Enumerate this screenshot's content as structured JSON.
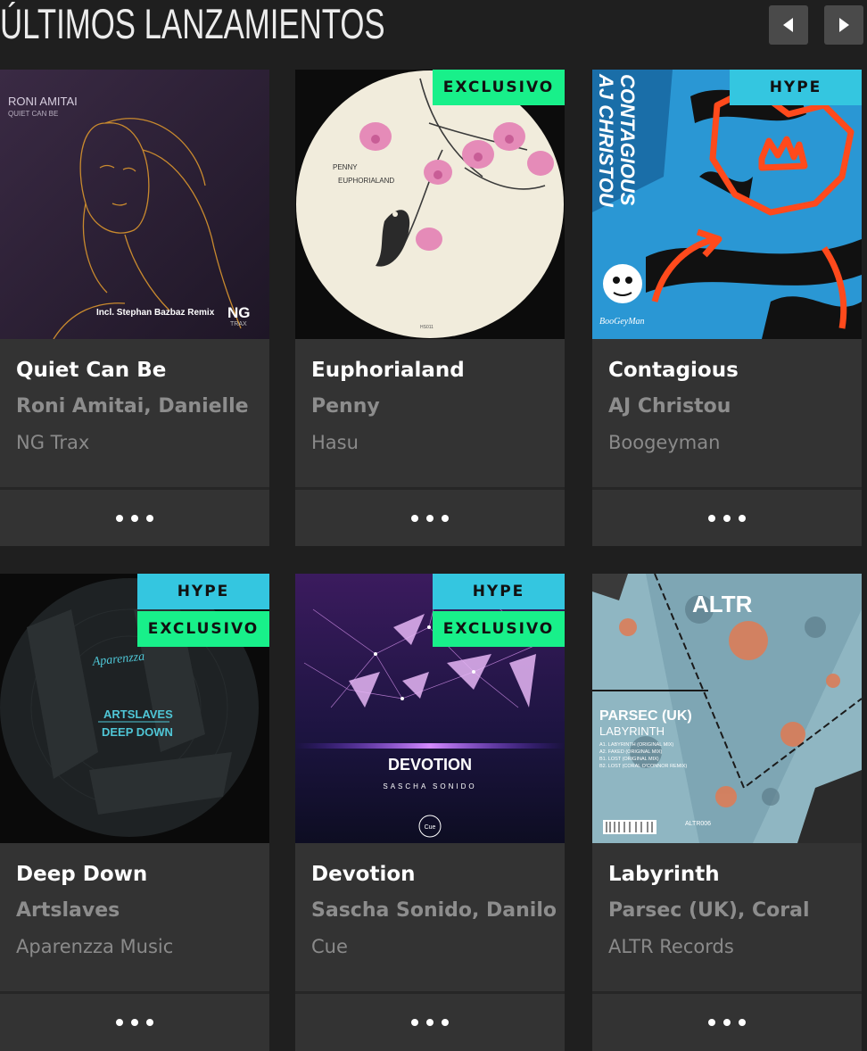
{
  "section": {
    "title": "ÚLTIMOS LANZAMIENTOS"
  },
  "nav": {
    "prev_icon": "caret-left-icon",
    "next_icon": "caret-right-icon"
  },
  "colors": {
    "hype": "#34c6e0",
    "exclusive": "#18f08a",
    "card_bg": "#333333",
    "page_bg": "#1f1f1f"
  },
  "releases": [
    {
      "title": "Quiet Can Be",
      "artists": "Roni Amitai, Danielle",
      "label": "NG Trax",
      "badges": [],
      "cover": {
        "line1": "RONI AMITAI",
        "line2": "QUIET CAN BE",
        "line3": "Incl. Stephan Bazbaz Remix",
        "logo": "NG",
        "logo_sub": "TRAX"
      }
    },
    {
      "title": "Euphorialand",
      "artists": "Penny",
      "label": "Hasu",
      "badges": [
        "EXCLUSIVO"
      ],
      "cover": {
        "line1": "PENNY",
        "line2": "EUPHORIALAND",
        "code": "HS011"
      }
    },
    {
      "title": "Contagious",
      "artists": "AJ Christou",
      "label": "Boogeyman",
      "badges": [
        "HYPE"
      ],
      "cover": {
        "line1": "AJ CHRISTOU",
        "line2": "CONTAGIOUS",
        "logo": "BooGeyMan"
      }
    },
    {
      "title": "Deep Down",
      "artists": "Artslaves",
      "label": "Aparenzza Music",
      "badges": [
        "HYPE",
        "EXCLUSIVO"
      ],
      "cover": {
        "line1": "ARTSLAVES",
        "line2": "DEEP DOWN"
      }
    },
    {
      "title": "Devotion",
      "artists": "Sascha Sonido, Danilo",
      "label": "Cue",
      "badges": [
        "HYPE",
        "EXCLUSIVO"
      ],
      "cover": {
        "line1": "DEVOTION",
        "line2": "SASCHA SONIDO",
        "logo": "Cue"
      }
    },
    {
      "title": "Labyrinth",
      "artists": "Parsec (UK), Coral",
      "label": "ALTR Records",
      "badges": [],
      "cover": {
        "logo": "ALTR",
        "line1": "PARSEC (UK)",
        "line2": "LABYRINTH",
        "tracks": [
          "A1. LABYRINTH (ORIGINAL MIX)",
          "A2. FAKED (ORIGINAL MIX)",
          "B1. LOST (ORIGINAL MIX)",
          "B2. LOST (CORAL O'CONNOR REMIX)"
        ],
        "code": "ALTR006"
      }
    }
  ]
}
